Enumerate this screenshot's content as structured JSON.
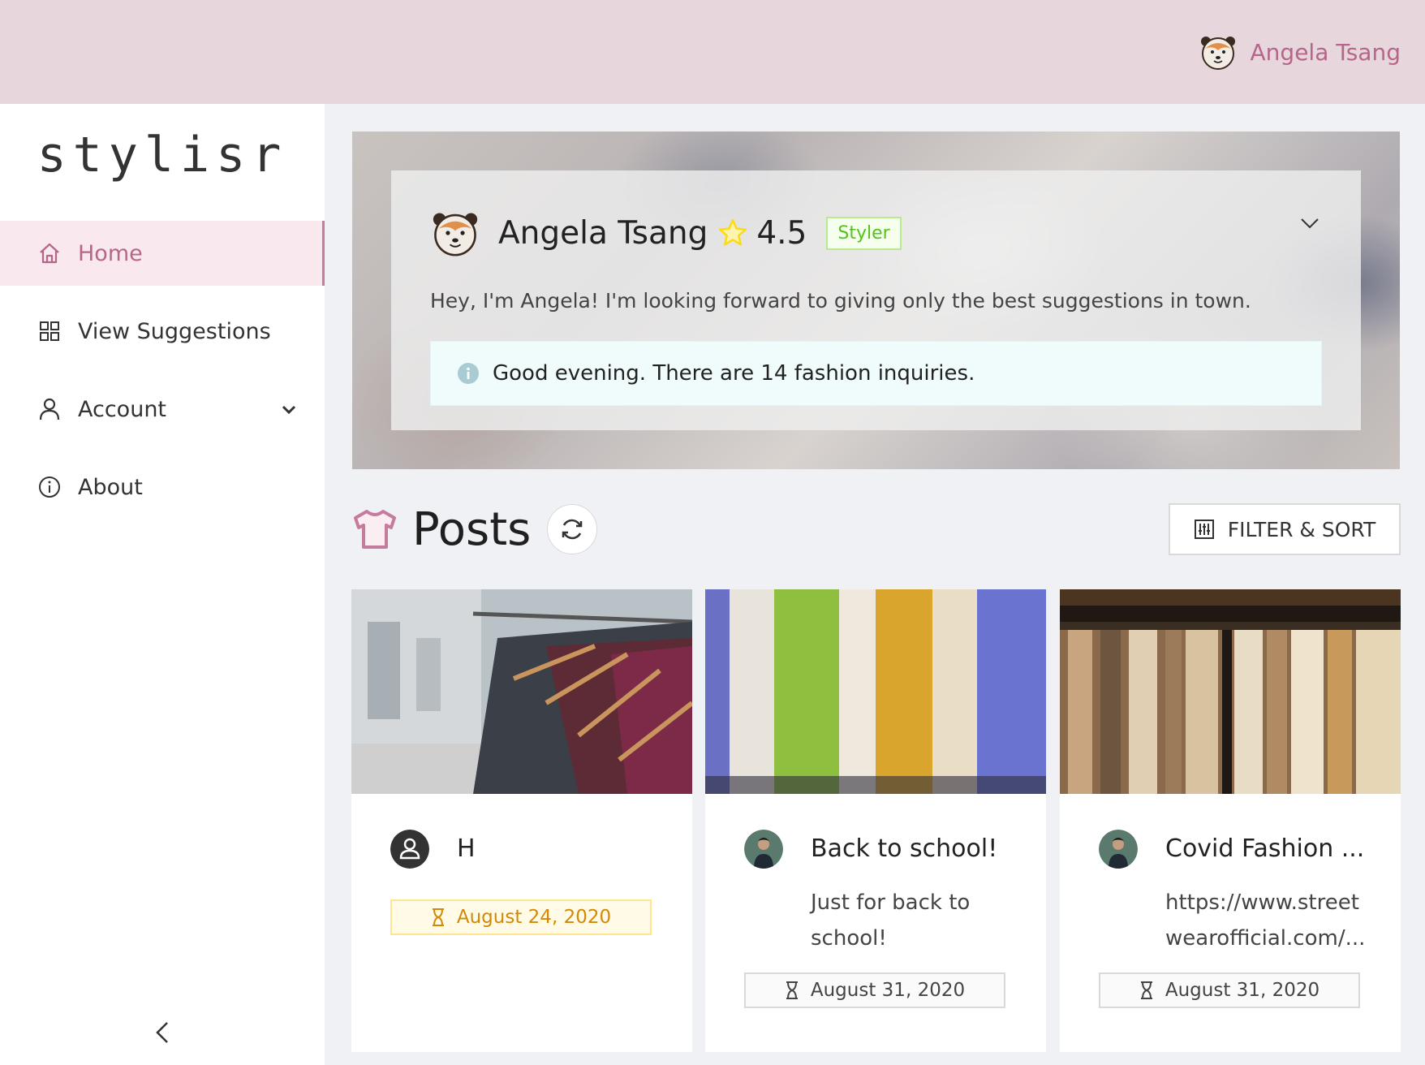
{
  "header": {
    "user_name": "Angela Tsang",
    "avatar_icon": "bear-avatar-icon"
  },
  "sidebar": {
    "logo": "stylisr",
    "items": [
      {
        "label": "Home",
        "icon": "home-icon",
        "active": true
      },
      {
        "label": "View Suggestions",
        "icon": "grid-icon"
      },
      {
        "label": "Account",
        "icon": "user-icon",
        "expandable": true
      },
      {
        "label": "About",
        "icon": "info-icon"
      }
    ]
  },
  "profile": {
    "name": "Angela Tsang",
    "rating": "4.5",
    "role": "Styler",
    "bio": "Hey, I'm Angela! I'm looking forward to giving only the best suggestions in town.",
    "alert": "Good evening. There are 14 fashion inquiries."
  },
  "posts": {
    "title": "Posts",
    "filter_label": "FILTER & SORT",
    "cards": [
      {
        "title": "H",
        "description": "",
        "date": "August 24, 2020",
        "date_style": "warning"
      },
      {
        "title": "Back to school!",
        "description": "Just for back to school!",
        "date": "August 31, 2020",
        "date_style": "default"
      },
      {
        "title": "Covid Fashion ...",
        "description": "https://www.streetwearofficial.com/...",
        "date": "August 31, 2020",
        "date_style": "default"
      }
    ]
  },
  "colors": {
    "accent": "#b5668a",
    "header_bg": "#e7d7dc",
    "active_bg": "#f9e8ed",
    "tag_green": "#52c41a",
    "tag_warning": "#d48806"
  }
}
